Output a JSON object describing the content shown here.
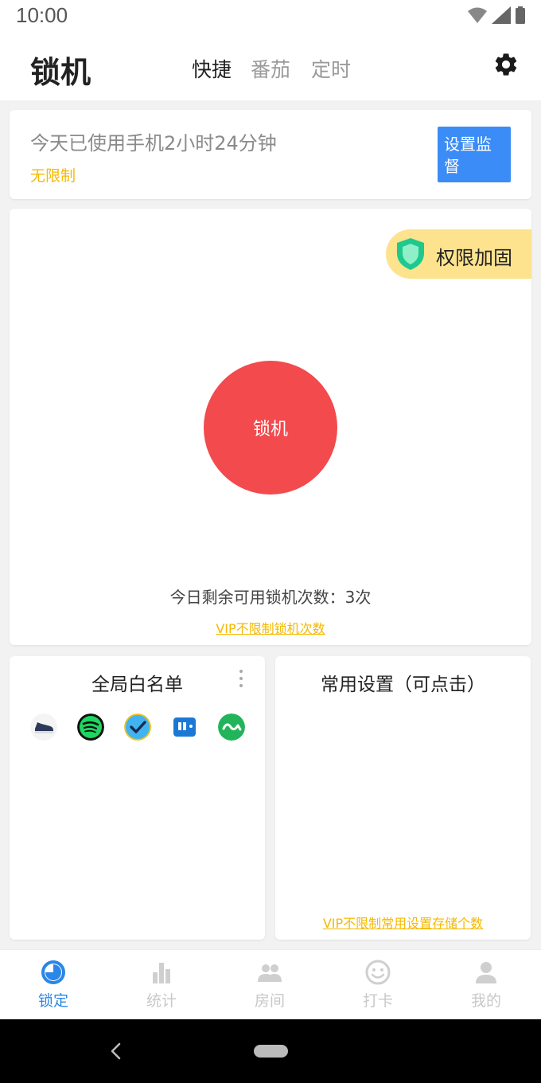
{
  "status_bar": {
    "time": "10:00",
    "icons": [
      "wifi-icon",
      "signal-icon",
      "battery-icon"
    ]
  },
  "app_bar": {
    "title": "锁机",
    "tabs": [
      {
        "label": "快捷",
        "active": true
      },
      {
        "label": "番茄",
        "active": false
      },
      {
        "label": "定时",
        "active": false
      }
    ],
    "settings_icon": "gear-icon"
  },
  "usage_card": {
    "usage_text": "今天已使用手机2小时24分钟",
    "limit_text": "无限制",
    "supervise_button": "设置监督"
  },
  "lock_card": {
    "permission_badge": "权限加固",
    "lock_button": "锁机",
    "remaining_text": "今日剩余可用锁机次数：3次",
    "vip_link": "VIP不限制锁机次数"
  },
  "whitelist_card": {
    "title": "全局白名单",
    "apps": [
      "navy-shoe-app-icon",
      "spotify-icon",
      "checkmark-app-icon",
      "wallet-app-icon",
      "green-infinity-app-icon"
    ]
  },
  "settings_card": {
    "title": "常用设置（可点击）",
    "vip_link": "VIP不限制常用设置存储个数"
  },
  "bottom_nav": {
    "items": [
      {
        "label": "锁定",
        "icon": "clock-icon",
        "active": true
      },
      {
        "label": "统计",
        "icon": "bar-chart-icon",
        "active": false
      },
      {
        "label": "房间",
        "icon": "people-icon",
        "active": false
      },
      {
        "label": "打卡",
        "icon": "smiley-icon",
        "active": false
      },
      {
        "label": "我的",
        "icon": "person-icon",
        "active": false
      }
    ]
  },
  "colors": {
    "accent_blue": "#3b8cf6",
    "lock_red": "#f24a4d",
    "vip_yellow": "#f5b900",
    "badge_yellow": "#fde38e",
    "nav_active": "#2a86e8"
  }
}
